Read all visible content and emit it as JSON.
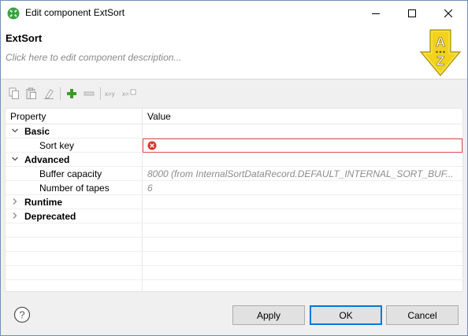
{
  "window": {
    "title": "Edit component ExtSort",
    "app_icon": "component-icon",
    "controls": [
      "minimize-icon",
      "maximize-icon",
      "close-icon"
    ]
  },
  "header": {
    "component_name": "ExtSort",
    "description_placeholder": "Click here to edit component description...",
    "component_icon": "sort-az-icon",
    "icon_letters": [
      "A",
      "Z"
    ]
  },
  "toolbar": {
    "buttons": [
      "copy-icon",
      "paste-icon",
      "clear-icon",
      "add-icon",
      "remove-icon",
      "x-equals-y-icon",
      "x-equals-expression-icon"
    ],
    "x_eq_y": "x=y",
    "x_eq_expr": "x="
  },
  "table": {
    "headers": {
      "property": "Property",
      "value": "Value"
    },
    "rows": [
      {
        "label": "Basic",
        "type": "group",
        "expanded": true
      },
      {
        "label": "Sort key",
        "type": "prop",
        "value": "",
        "error": true
      },
      {
        "label": "Advanced",
        "type": "group",
        "expanded": true
      },
      {
        "label": "Buffer capacity",
        "type": "prop",
        "value": "8000 (from InternalSortDataRecord.DEFAULT_INTERNAL_SORT_BUF..."
      },
      {
        "label": "Number of tapes",
        "type": "prop",
        "value": "6"
      },
      {
        "label": "Runtime",
        "type": "group",
        "expanded": false
      },
      {
        "label": "Deprecated",
        "type": "group",
        "expanded": false
      }
    ]
  },
  "footer": {
    "help_icon": "help-icon",
    "help_glyph": "?",
    "apply_label": "Apply",
    "ok_label": "OK",
    "cancel_label": "Cancel"
  },
  "colors": {
    "error_border": "#e24b4b",
    "accent": "#0078d7",
    "sort_icon_yellow": "#f2d21b",
    "add_green": "#3c9a2a"
  }
}
